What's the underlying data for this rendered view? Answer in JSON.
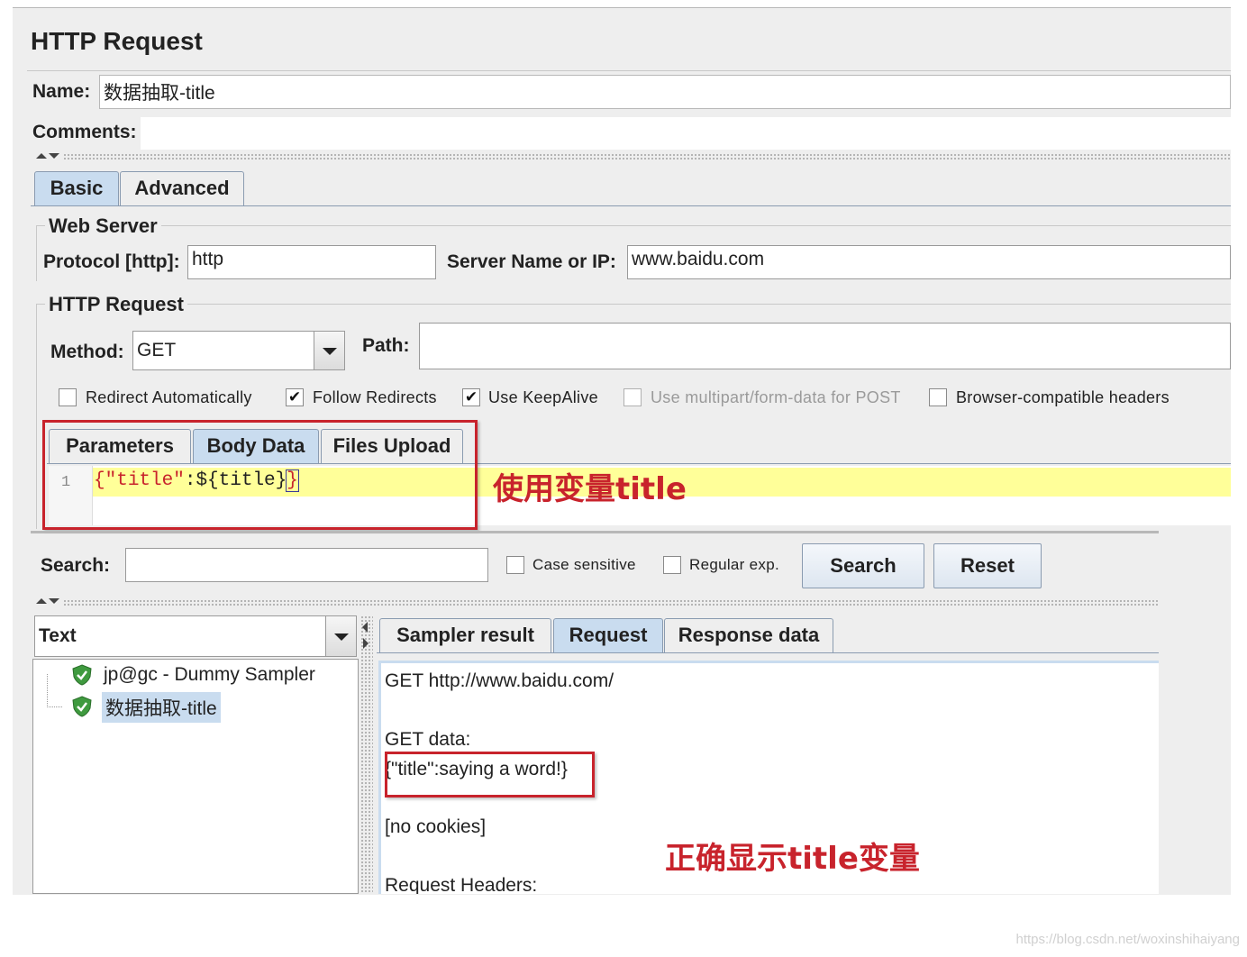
{
  "header": {
    "title": "HTTP Request"
  },
  "name_field": {
    "label": "Name:",
    "value": "数据抽取-title"
  },
  "comments_field": {
    "label": "Comments:",
    "value": ""
  },
  "main_tabs": [
    {
      "label": "Basic",
      "active": true
    },
    {
      "label": "Advanced",
      "active": false
    }
  ],
  "web_server": {
    "legend": "Web Server",
    "protocol_label": "Protocol [http]:",
    "protocol_value": "http",
    "server_label": "Server Name or IP:",
    "server_value": "www.baidu.com"
  },
  "http_request": {
    "legend": "HTTP Request",
    "method_label": "Method:",
    "method_value": "GET",
    "path_label": "Path:",
    "path_value": ""
  },
  "options": [
    {
      "label": "Redirect Automatically",
      "checked": false,
      "enabled": true
    },
    {
      "label": "Follow Redirects",
      "checked": true,
      "enabled": true
    },
    {
      "label": "Use KeepAlive",
      "checked": true,
      "enabled": true
    },
    {
      "label": "Use multipart/form-data for POST",
      "checked": false,
      "enabled": false
    },
    {
      "label": "Browser-compatible headers",
      "checked": false,
      "enabled": true
    }
  ],
  "body_tabs": [
    {
      "label": "Parameters",
      "active": false
    },
    {
      "label": "Body Data",
      "active": true
    },
    {
      "label": "Files Upload",
      "active": false
    }
  ],
  "body_editor": {
    "line_number": "1",
    "code_open": "{",
    "code_key": "\"title\"",
    "code_colon": ":",
    "code_var": "${title}",
    "code_close": "}"
  },
  "annotation_top": "使用变量title",
  "search_bar": {
    "label": "Search:",
    "value": "",
    "case_sensitive": "Case sensitive",
    "regular_exp": "Regular exp.",
    "search_button": "Search",
    "reset_button": "Reset"
  },
  "renderer_select": {
    "value": "Text"
  },
  "results_tree": [
    {
      "label": "jp@gc - Dummy Sampler",
      "status": "success"
    },
    {
      "label": "数据抽取-title",
      "status": "success",
      "selected": true
    }
  ],
  "result_tabs": [
    {
      "label": "Sampler result",
      "active": false
    },
    {
      "label": "Request",
      "active": true
    },
    {
      "label": "Response data",
      "active": false
    }
  ],
  "request_view": {
    "line1": "GET http://www.baidu.com/",
    "line2": "GET data:",
    "line3": "{\"title\":saying a word!}",
    "line4": "[no cookies]",
    "line5": "Request Headers:"
  },
  "annotation_bottom": "正确显示title变量",
  "watermark": "https://blog.csdn.net/woxinshihaiyang",
  "colors": {
    "accent_tab": "#c9dcef",
    "annotation_red": "#c8232c",
    "editor_highlight": "#ffff99"
  }
}
